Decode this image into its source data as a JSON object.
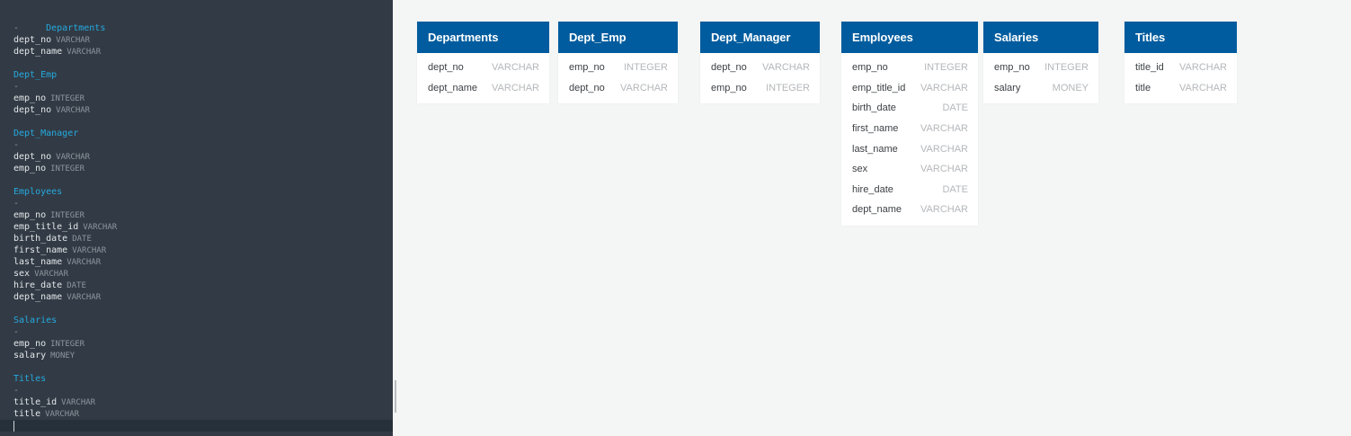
{
  "editor": {
    "separator": "-",
    "tables": [
      {
        "name": "Departments",
        "columns": [
          {
            "name": "dept_no",
            "type": "VARCHAR"
          },
          {
            "name": "dept_name",
            "type": "VARCHAR"
          }
        ]
      },
      {
        "name": "Dept_Emp",
        "columns": [
          {
            "name": "emp_no",
            "type": "INTEGER"
          },
          {
            "name": "dept_no",
            "type": "VARCHAR"
          }
        ]
      },
      {
        "name": "Dept_Manager",
        "columns": [
          {
            "name": "dept_no",
            "type": "VARCHAR"
          },
          {
            "name": "emp_no",
            "type": "INTEGER"
          }
        ]
      },
      {
        "name": "Employees",
        "columns": [
          {
            "name": "emp_no",
            "type": "INTEGER"
          },
          {
            "name": "emp_title_id",
            "type": "VARCHAR"
          },
          {
            "name": "birth_date",
            "type": "DATE"
          },
          {
            "name": "first_name",
            "type": "VARCHAR"
          },
          {
            "name": "last_name",
            "type": "VARCHAR"
          },
          {
            "name": "sex",
            "type": "VARCHAR"
          },
          {
            "name": "hire_date",
            "type": "DATE"
          },
          {
            "name": "dept_name",
            "type": "VARCHAR"
          }
        ]
      },
      {
        "name": "Salaries",
        "columns": [
          {
            "name": "emp_no",
            "type": "INTEGER"
          },
          {
            "name": "salary",
            "type": "MONEY"
          }
        ]
      },
      {
        "name": "Titles",
        "columns": [
          {
            "name": "title_id",
            "type": "VARCHAR"
          },
          {
            "name": "title",
            "type": "VARCHAR"
          }
        ]
      }
    ]
  },
  "diagram": {
    "header_color": "#005c9e",
    "tables": [
      {
        "name": "Departments",
        "columns": [
          {
            "name": "dept_no",
            "type": "VARCHAR"
          },
          {
            "name": "dept_name",
            "type": "VARCHAR"
          }
        ]
      },
      {
        "name": "Dept_Emp",
        "columns": [
          {
            "name": "emp_no",
            "type": "INTEGER"
          },
          {
            "name": "dept_no",
            "type": "VARCHAR"
          }
        ]
      },
      {
        "name": "Dept_Manager",
        "columns": [
          {
            "name": "dept_no",
            "type": "VARCHAR"
          },
          {
            "name": "emp_no",
            "type": "INTEGER"
          }
        ]
      },
      {
        "name": "Employees",
        "columns": [
          {
            "name": "emp_no",
            "type": "INTEGER"
          },
          {
            "name": "emp_title_id",
            "type": "VARCHAR"
          },
          {
            "name": "birth_date",
            "type": "DATE"
          },
          {
            "name": "first_name",
            "type": "VARCHAR"
          },
          {
            "name": "last_name",
            "type": "VARCHAR"
          },
          {
            "name": "sex",
            "type": "VARCHAR"
          },
          {
            "name": "hire_date",
            "type": "DATE"
          },
          {
            "name": "dept_name",
            "type": "VARCHAR"
          }
        ]
      },
      {
        "name": "Salaries",
        "columns": [
          {
            "name": "emp_no",
            "type": "INTEGER"
          },
          {
            "name": "salary",
            "type": "MONEY"
          }
        ]
      },
      {
        "name": "Titles",
        "columns": [
          {
            "name": "title_id",
            "type": "VARCHAR"
          },
          {
            "name": "title",
            "type": "VARCHAR"
          }
        ]
      }
    ]
  }
}
